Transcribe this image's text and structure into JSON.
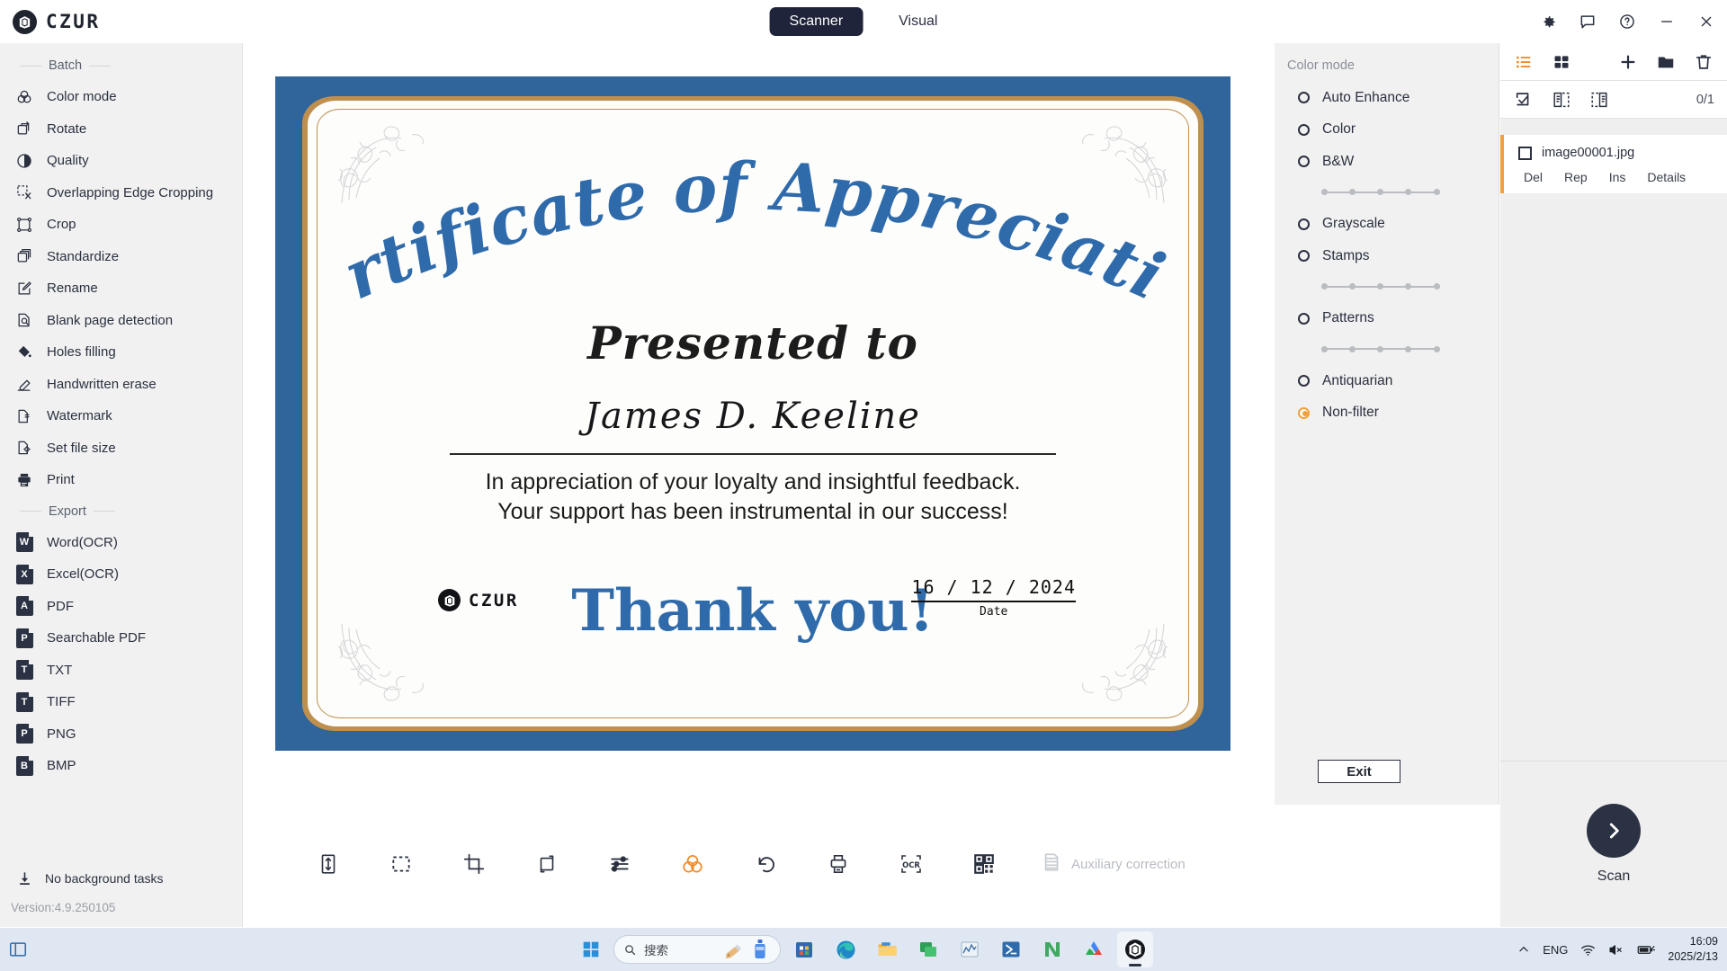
{
  "app": {
    "brand": "CZUR",
    "version_label": "Version:4.9.250105",
    "background_task": "No background tasks"
  },
  "header": {
    "tabs": [
      {
        "label": "Scanner",
        "active": true
      },
      {
        "label": "Visual",
        "active": false
      }
    ],
    "window_icons": [
      "gear-icon",
      "feedback-icon",
      "help-icon",
      "minimize-icon",
      "close-icon"
    ]
  },
  "sidebar": {
    "groups": [
      {
        "title": "Batch",
        "items": [
          {
            "label": "Color mode",
            "icon": "color-mode-icon"
          },
          {
            "label": "Rotate",
            "icon": "rotate-icon"
          },
          {
            "label": "Quality",
            "icon": "quality-icon"
          },
          {
            "label": "Overlapping Edge Cropping",
            "icon": "overlap-crop-icon"
          },
          {
            "label": "Crop",
            "icon": "crop-icon"
          },
          {
            "label": "Standardize",
            "icon": "standardize-icon"
          },
          {
            "label": "Rename",
            "icon": "rename-icon"
          },
          {
            "label": "Blank page detection",
            "icon": "blank-page-icon"
          },
          {
            "label": "Holes filling",
            "icon": "holes-filling-icon"
          },
          {
            "label": "Handwritten erase",
            "icon": "handwritten-erase-icon"
          },
          {
            "label": "Watermark",
            "icon": "watermark-icon"
          },
          {
            "label": "Set file size",
            "icon": "set-file-size-icon"
          },
          {
            "label": "Print",
            "icon": "print-icon"
          }
        ]
      },
      {
        "title": "Export",
        "items": [
          {
            "label": "Word(OCR)",
            "icon": "word-icon",
            "badge": "W"
          },
          {
            "label": "Excel(OCR)",
            "icon": "excel-icon",
            "badge": "X"
          },
          {
            "label": "PDF",
            "icon": "pdf-icon",
            "badge": "A"
          },
          {
            "label": "Searchable PDF",
            "icon": "searchable-pdf-icon",
            "badge": "P"
          },
          {
            "label": "TXT",
            "icon": "txt-icon",
            "badge": "T"
          },
          {
            "label": "TIFF",
            "icon": "tiff-icon",
            "badge": "T"
          },
          {
            "label": "PNG",
            "icon": "png-icon",
            "badge": "P"
          },
          {
            "label": "BMP",
            "icon": "bmp-icon",
            "badge": "B"
          }
        ]
      }
    ]
  },
  "certificate": {
    "title": "Certificate of Appreciation",
    "presented_to": "Presented to",
    "recipient": "James D. Keeline",
    "body_line1": "In appreciation of your loyalty and insightful feedback.",
    "body_line2": "Your support has been instrumental in our success!",
    "thanks": "Thank you!",
    "logo_text": "CZUR",
    "date_value": "16 / 12 / 2024",
    "date_label": "Date",
    "colors": {
      "border_blue": "#2f659a",
      "border_gold": "#bf8f4e",
      "title_blue": "#2f6bab"
    }
  },
  "toolbar": {
    "buttons": [
      {
        "name": "fit-height-icon",
        "label": "Fit height"
      },
      {
        "name": "select-area-icon",
        "label": "Select area"
      },
      {
        "name": "crop-icon",
        "label": "Crop"
      },
      {
        "name": "rotate-page-icon",
        "label": "Rotate page"
      },
      {
        "name": "adjust-icon",
        "label": "Adjust"
      },
      {
        "name": "color-mode-icon",
        "label": "Color mode",
        "active": true
      },
      {
        "name": "undo-icon",
        "label": "Undo"
      },
      {
        "name": "print-icon",
        "label": "Print"
      },
      {
        "name": "ocr-icon",
        "label": "OCR"
      },
      {
        "name": "qrcode-icon",
        "label": "QR code"
      }
    ],
    "auxiliary_label": "Auxiliary correction",
    "accent_color": "#f08b2b"
  },
  "color_mode": {
    "title": "Color mode",
    "options": [
      {
        "label": "Auto Enhance",
        "selected": false,
        "slider": false
      },
      {
        "label": "Color",
        "selected": false,
        "slider": false
      },
      {
        "label": "B&W",
        "selected": false,
        "slider": true
      },
      {
        "label": "Grayscale",
        "selected": false,
        "slider": false
      },
      {
        "label": "Stamps",
        "selected": false,
        "slider": true
      },
      {
        "label": "Patterns",
        "selected": false,
        "slider": true
      },
      {
        "label": "Antiquarian",
        "selected": false,
        "slider": false
      },
      {
        "label": "Non-filter",
        "selected": true,
        "slider": false
      }
    ],
    "exit_label": "Exit",
    "selected_color": "#f0a03c"
  },
  "file_panel": {
    "toolbar_icons": [
      "list-view-icon",
      "grid-view-icon",
      "add-icon",
      "folder-icon",
      "delete-icon"
    ],
    "select_icons": [
      "select-all-icon",
      "select-odd-icon",
      "select-even-icon"
    ],
    "count": "0/1",
    "files": [
      {
        "name": "image00001.jpg",
        "checked": false,
        "actions": [
          "Del",
          "Rep",
          "Ins",
          "Details"
        ]
      }
    ],
    "scan_label": "Scan",
    "accent_color": "#f0a03c"
  },
  "taskbar": {
    "search_placeholder": "搜索",
    "apps": [
      {
        "name": "store-icon",
        "running": false
      },
      {
        "name": "edge-icon",
        "running": true
      },
      {
        "name": "file-explorer-icon",
        "running": true
      },
      {
        "name": "messaging-icon",
        "running": false
      },
      {
        "name": "chart-app-icon",
        "running": false
      },
      {
        "name": "powershell-icon",
        "running": false
      },
      {
        "name": "neovim-icon",
        "running": false
      },
      {
        "name": "drive-icon",
        "running": false
      },
      {
        "name": "czur-app-icon",
        "running": true,
        "active": true
      }
    ],
    "tray": {
      "chevron": "show-hidden-icons",
      "language": "ENG",
      "icons": [
        "wifi-icon",
        "mute-icon",
        "battery-icon"
      ],
      "time": "16:09",
      "date": "2025/2/13"
    }
  }
}
